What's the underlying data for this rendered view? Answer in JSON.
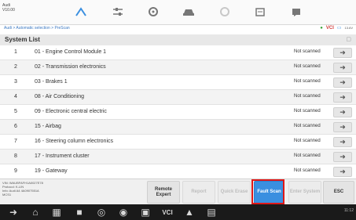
{
  "vehicle": {
    "make": "Audi",
    "model": "V10.00"
  },
  "breadcrumb": "Audi > Automatic selection > PreScan",
  "status_icons": {
    "vci": "VCI",
    "battery": "13.6V"
  },
  "list_title": "System List",
  "systems": [
    {
      "num": "1",
      "name": "01 - Engine Control Module 1",
      "status": "Not scanned"
    },
    {
      "num": "2",
      "name": "02 - Transmission electronics",
      "status": "Not scanned"
    },
    {
      "num": "3",
      "name": "03 - Brakes 1",
      "status": "Not scanned"
    },
    {
      "num": "4",
      "name": "08 - Air Conditioning",
      "status": "Not scanned"
    },
    {
      "num": "5",
      "name": "09 - Electronic central electric",
      "status": "Not scanned"
    },
    {
      "num": "6",
      "name": "15 - Airbag",
      "status": "Not scanned"
    },
    {
      "num": "7",
      "name": "16 - Steering column electronics",
      "status": "Not scanned"
    },
    {
      "num": "8",
      "name": "17 - Instrument cluster",
      "status": "Not scanned"
    },
    {
      "num": "9",
      "name": "19 - Gateway",
      "status": "Not scanned"
    }
  ],
  "vehicle_info": {
    "vin": "VIN: WAUBFAFH1A0027E78",
    "protocol": "Protocol: K-LIN",
    "info": "Info: Audi A4 4A0907551A",
    "extra": "MCS1"
  },
  "buttons": {
    "remote_expert": "Remote Expert",
    "report": "Report",
    "quick_erase": "Quick Erase",
    "fault_scan": "Fault Scan",
    "enter_system": "Enter System",
    "esc": "ESC"
  },
  "system_status": "11:12",
  "colors": {
    "accent": "#3a8fe0",
    "highlight": "#e01818"
  }
}
